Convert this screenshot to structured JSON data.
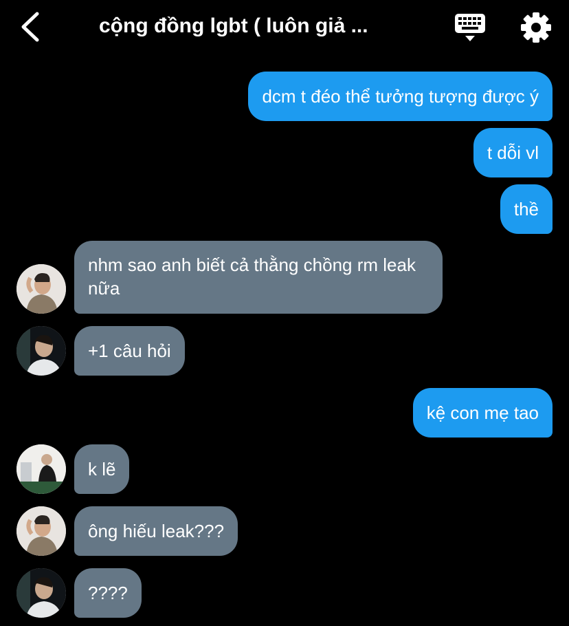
{
  "header": {
    "title": "cộng đồng lgbt ( luôn giả ..."
  },
  "messages": [
    {
      "side": "out",
      "text": "dcm t đéo thể tưởng tượng được ý"
    },
    {
      "side": "out",
      "text": "t dỗi vl"
    },
    {
      "side": "out",
      "text": "thề"
    },
    {
      "side": "in",
      "avatar": "avatar-a",
      "text": "nhm sao anh biết cả thằng chồng rm leak nữa"
    },
    {
      "side": "in",
      "avatar": "avatar-b",
      "text": "+1 câu hỏi"
    },
    {
      "side": "out",
      "text": "kệ con mẹ tao"
    },
    {
      "side": "in",
      "avatar": "avatar-c",
      "text": "k lẽ"
    },
    {
      "side": "in",
      "avatar": "avatar-a",
      "text": "ông hiếu leak???"
    },
    {
      "side": "in",
      "avatar": "avatar-b",
      "text": "????"
    }
  ],
  "icons": {
    "back": "chevron-left-icon",
    "keyboard": "keyboard-icon",
    "settings": "gear-icon"
  },
  "colors": {
    "background": "#000000",
    "outgoing_bubble": "#1d9bf0",
    "incoming_bubble": "#657786",
    "text": "#ffffff"
  }
}
